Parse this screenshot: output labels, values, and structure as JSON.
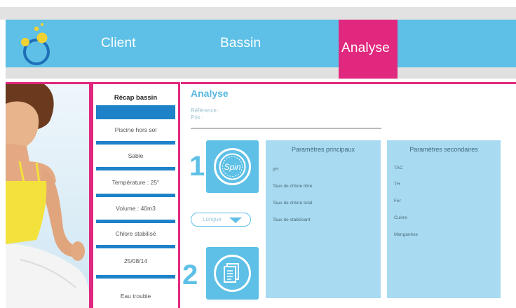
{
  "nav": {
    "tabs": [
      {
        "label": "Client"
      },
      {
        "label": "Bassin"
      },
      {
        "label": "Analyse"
      }
    ],
    "active_color": "#e0287e",
    "bar_color": "#5ec0e6"
  },
  "recap": {
    "title": "Récap bassin",
    "items": [
      {
        "label": "Piscine hors sol"
      },
      {
        "label": "Sable"
      },
      {
        "label": "Température : 25°"
      },
      {
        "label": "Volume : 40m3"
      },
      {
        "label": "Chlore stabilisé"
      },
      {
        "label": "25/08/14"
      },
      {
        "label": "Eau trouble"
      }
    ]
  },
  "main": {
    "title": "Analyse",
    "reference_label": "Référence :",
    "price_label": "Prix :",
    "step1_number": "1",
    "step2_number": "2",
    "step1_icon_text": "Spin",
    "select_value": "Longue",
    "primary_params": {
      "title": "Paramètres principaux",
      "items": [
        "pH",
        "Taux de chlore libre",
        "Taux de chlore total",
        "Taux de stabilisant"
      ]
    },
    "secondary_params": {
      "title": "Paramètres secondaires",
      "items": [
        "TAC",
        "TH",
        "Fer",
        "Cuivre",
        "Manganèse"
      ]
    }
  },
  "colors": {
    "accent_pink": "#e0287e",
    "light_blue": "#5ec0e6",
    "panel_blue": "#a8daf1",
    "dark_blue": "#1e82c8"
  }
}
